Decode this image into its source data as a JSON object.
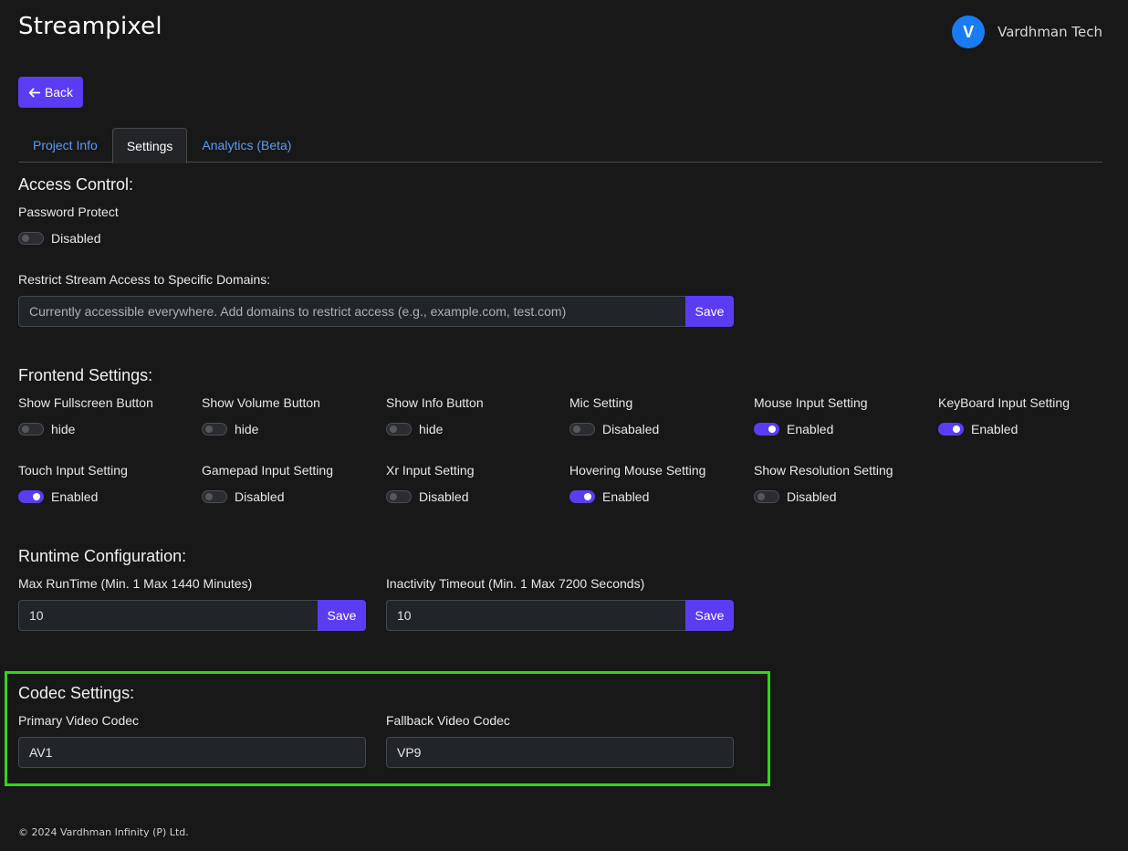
{
  "header": {
    "brand": "Streampixel",
    "avatar_letter": "V",
    "user_name": "Vardhman Tech"
  },
  "back_label": "Back",
  "tabs": [
    {
      "label": "Project Info",
      "active": false
    },
    {
      "label": "Settings",
      "active": true
    },
    {
      "label": "Analytics (Beta)",
      "active": false
    }
  ],
  "access_control": {
    "heading": "Access Control:",
    "password_label": "Password Protect",
    "password_state": "Disabled",
    "password_on": false,
    "domains_label": "Restrict Stream Access to Specific Domains:",
    "domains_placeholder": "Currently accessible everywhere. Add domains to restrict access (e.g., example.com, test.com)",
    "save_label": "Save"
  },
  "frontend": {
    "heading": "Frontend Settings:",
    "items": [
      {
        "label": "Show Fullscreen Button",
        "state": "hide",
        "on": false
      },
      {
        "label": "Show Volume Button",
        "state": "hide",
        "on": false
      },
      {
        "label": "Show Info Button",
        "state": "hide",
        "on": false
      },
      {
        "label": "Mic Setting",
        "state": "Disabaled",
        "on": false
      },
      {
        "label": "Mouse Input Setting",
        "state": "Enabled",
        "on": true
      },
      {
        "label": "KeyBoard Input Setting",
        "state": "Enabled",
        "on": true
      },
      {
        "label": "Touch Input Setting",
        "state": "Enabled",
        "on": true
      },
      {
        "label": "Gamepad Input Setting",
        "state": "Disabled",
        "on": false
      },
      {
        "label": "Xr Input Setting",
        "state": "Disabled",
        "on": false
      },
      {
        "label": "Hovering Mouse Setting",
        "state": "Enabled",
        "on": true
      },
      {
        "label": "Show Resolution Setting",
        "state": "Disabled",
        "on": false
      }
    ]
  },
  "runtime": {
    "heading": "Runtime Configuration:",
    "max_runtime_label": "Max RunTime (Min. 1 Max 1440 Minutes)",
    "max_runtime_value": "10",
    "inactivity_label": "Inactivity Timeout (Min. 1 Max 7200 Seconds)",
    "inactivity_value": "10",
    "save_label": "Save"
  },
  "codec": {
    "heading": "Codec Settings:",
    "primary_label": "Primary Video Codec",
    "primary_value": "AV1",
    "fallback_label": "Fallback Video Codec",
    "fallback_value": "VP9",
    "highlight_color": "#35d31c"
  },
  "footer": "© 2024 Vardhman Infinity (P) Ltd.",
  "colors": {
    "accent": "#5b3cf2",
    "avatar": "#1a7cf5",
    "tab_link": "#5b9cf5",
    "background": "#181818"
  }
}
